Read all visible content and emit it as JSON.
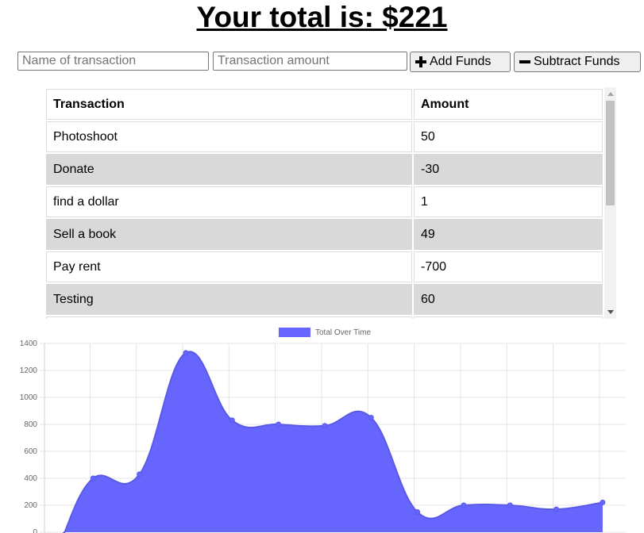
{
  "header": {
    "total_text": "Your total is: $221"
  },
  "form": {
    "name_placeholder": "Name of transaction",
    "amount_placeholder": "Transaction amount",
    "add_label": "Add Funds",
    "subtract_label": "Subtract Funds",
    "add_icon": "plus-icon",
    "subtract_icon": "minus-icon"
  },
  "table": {
    "headers": [
      "Transaction",
      "Amount"
    ],
    "rows": [
      {
        "name": "Photoshoot",
        "amount": "50"
      },
      {
        "name": "Donate",
        "amount": "-30"
      },
      {
        "name": "find a dollar",
        "amount": "1"
      },
      {
        "name": "Sell a book",
        "amount": "49"
      },
      {
        "name": "Pay rent",
        "amount": "-700"
      },
      {
        "name": "Testing",
        "amount": "60"
      }
    ],
    "alt_row_color": "#d9d9d9"
  },
  "chart_data": {
    "type": "area",
    "legend": {
      "label": "Total Over Time",
      "position": "top"
    },
    "ylim": [
      0,
      1400
    ],
    "yticks": [
      0,
      200,
      400,
      600,
      800,
      1000,
      1200,
      1400
    ],
    "grid": true,
    "series": [
      {
        "name": "Total Over Time",
        "color": "#6666ff",
        "values": [
          -30,
          400,
          430,
          1330,
          830,
          800,
          790,
          850,
          150,
          200,
          200,
          170,
          221
        ]
      }
    ]
  }
}
